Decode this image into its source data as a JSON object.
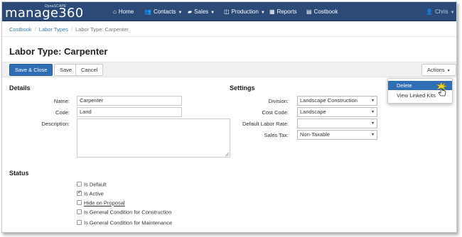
{
  "brand": {
    "small": "DynaSCAPE",
    "name": "manage360"
  },
  "nav": {
    "home": "Home",
    "contacts": "Contacts",
    "sales": "Sales",
    "production": "Production",
    "reports": "Reports",
    "costbook": "Costbook",
    "user": "Chris"
  },
  "breadcrumb": [
    "Costbook",
    "Labor Types",
    "Labor Type: Carpenter"
  ],
  "page_title": "Labor Type: Carpenter",
  "toolbar": {
    "save_close": "Save & Close",
    "save": "Save",
    "cancel": "Cancel",
    "actions": "Actions"
  },
  "actions_menu": {
    "delete": "Delete",
    "view_linked_kits": "View Linked Kits"
  },
  "details": {
    "heading": "Details",
    "name_label": "Name:",
    "name_value": "Carpenter",
    "code_label": "Code:",
    "code_value": "Land",
    "description_label": "Description:"
  },
  "settings": {
    "heading": "Settings",
    "division_label": "Division:",
    "division_value": "Landscape Construction",
    "cost_code_label": "Cost Code:",
    "cost_code_value": "Landscape",
    "labor_rate_label": "Default Labor Rate:",
    "labor_rate_value": "",
    "sales_tax_label": "Sales Tax:",
    "sales_tax_value": "Non-Taxable"
  },
  "status": {
    "heading": "Status",
    "is_default": "Is Default",
    "is_default_checked": false,
    "is_active": "Is Active",
    "is_active_checked": true,
    "hide_on_proposal": "Hide on Proposal",
    "hide_on_proposal_checked": false,
    "gc_construction": "Is General Condition for Construction",
    "gc_construction_checked": false,
    "gc_maintenance": "Is General Condition for Maintenance",
    "gc_maintenance_checked": false
  },
  "colors": {
    "navbar": "#2c4a78",
    "primary": "#2f6db5",
    "link": "#337ab7"
  }
}
